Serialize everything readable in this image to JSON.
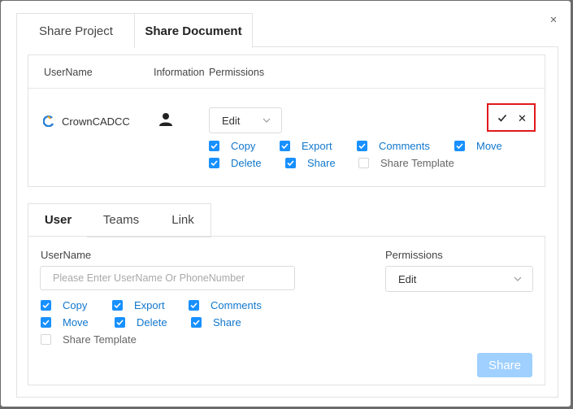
{
  "dialog": {
    "close_glyph": "×",
    "tabs": [
      {
        "label": "Share Project"
      },
      {
        "label": "Share Document"
      }
    ]
  },
  "doc_share": {
    "header": {
      "username": "UserName",
      "information": "Information",
      "permissions": "Permissions"
    },
    "row": {
      "username": "CrownCADCC",
      "permission": "Edit",
      "permissions": [
        {
          "label": "Copy",
          "checked": true
        },
        {
          "label": "Export",
          "checked": true
        },
        {
          "label": "Comments",
          "checked": true
        },
        {
          "label": "Move",
          "checked": true
        },
        {
          "label": "Delete",
          "checked": true
        },
        {
          "label": "Share",
          "checked": true
        },
        {
          "label": "Share Template",
          "checked": false
        }
      ],
      "confirm_glyph": "✓",
      "cancel_glyph": "✕"
    }
  },
  "add_share": {
    "tabs": [
      {
        "label": "User"
      },
      {
        "label": "Teams"
      },
      {
        "label": "Link"
      }
    ],
    "username_label": "UserName",
    "username_placeholder": "Please Enter UserName Or PhoneNumber",
    "permissions_label": "Permissions",
    "permission": "Edit",
    "permissions": [
      {
        "label": "Copy",
        "checked": true
      },
      {
        "label": "Export",
        "checked": true
      },
      {
        "label": "Comments",
        "checked": true
      },
      {
        "label": "Move",
        "checked": true
      },
      {
        "label": "Delete",
        "checked": true
      },
      {
        "label": "Share",
        "checked": true
      },
      {
        "label": "Share Template",
        "checked": false
      }
    ],
    "share_button": "Share"
  },
  "colors": {
    "accent": "#1890ff",
    "link_text": "#1177cc",
    "highlight_border": "#e0191b",
    "disabled_button": "#9fd0ff"
  }
}
